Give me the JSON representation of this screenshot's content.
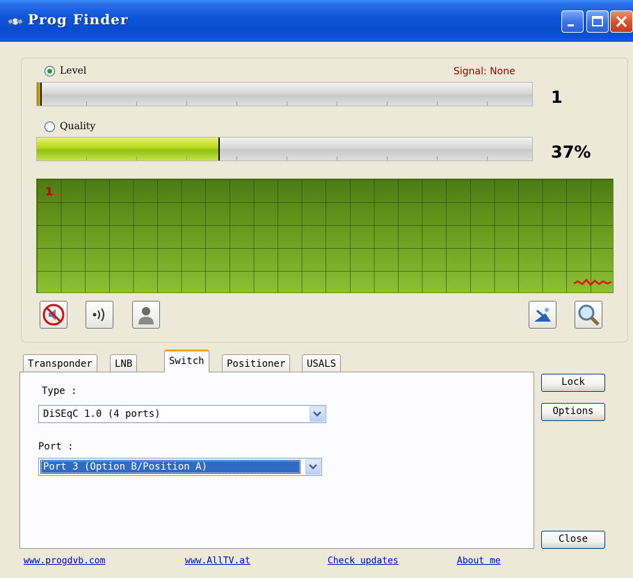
{
  "window": {
    "title": "Prog Finder",
    "icon": "satellite-icon",
    "controls": [
      "minimize-icon",
      "maximize-icon",
      "close-icon"
    ]
  },
  "signal": {
    "level_label": "Level",
    "level_selected": true,
    "signal_status": "Signal: None",
    "level_value": "1",
    "level_fraction": 0.01,
    "quality_label": "Quality",
    "quality_selected": false,
    "quality_value": "37%",
    "quality_fraction": 0.37,
    "scope_label": "1",
    "status_color": "#a00000"
  },
  "toolbar": {
    "left_icons": [
      "mute-speaker-icon",
      "sound-waves-icon",
      "user-icon"
    ],
    "right_icons": [
      "satellite-dish-icon",
      "search-icon"
    ]
  },
  "tabs": [
    {
      "label": "Transponder",
      "active": false
    },
    {
      "label": "LNB",
      "active": false
    },
    {
      "label": "Switch",
      "active": true
    },
    {
      "label": "Positioner",
      "active": false
    },
    {
      "label": "USALS",
      "active": false
    }
  ],
  "switch_page": {
    "type_label": "Type :",
    "type_value": "DiSEqC 1.0 (4 ports)",
    "port_label": "Port :",
    "port_value": "Port 3 (Option B/Position A)"
  },
  "buttons": {
    "lock": "Lock",
    "options": "Options",
    "close": "Close"
  },
  "links": [
    "www.progdvb.com",
    "www.AllTV.at",
    "Check updates",
    "About me"
  ],
  "colors": {
    "titlebar": "#0a4ccf",
    "scope_green": "#6a9a1e",
    "quality_fill": "#b6d818",
    "selection": "#316ac5",
    "link": "#0000cc"
  }
}
